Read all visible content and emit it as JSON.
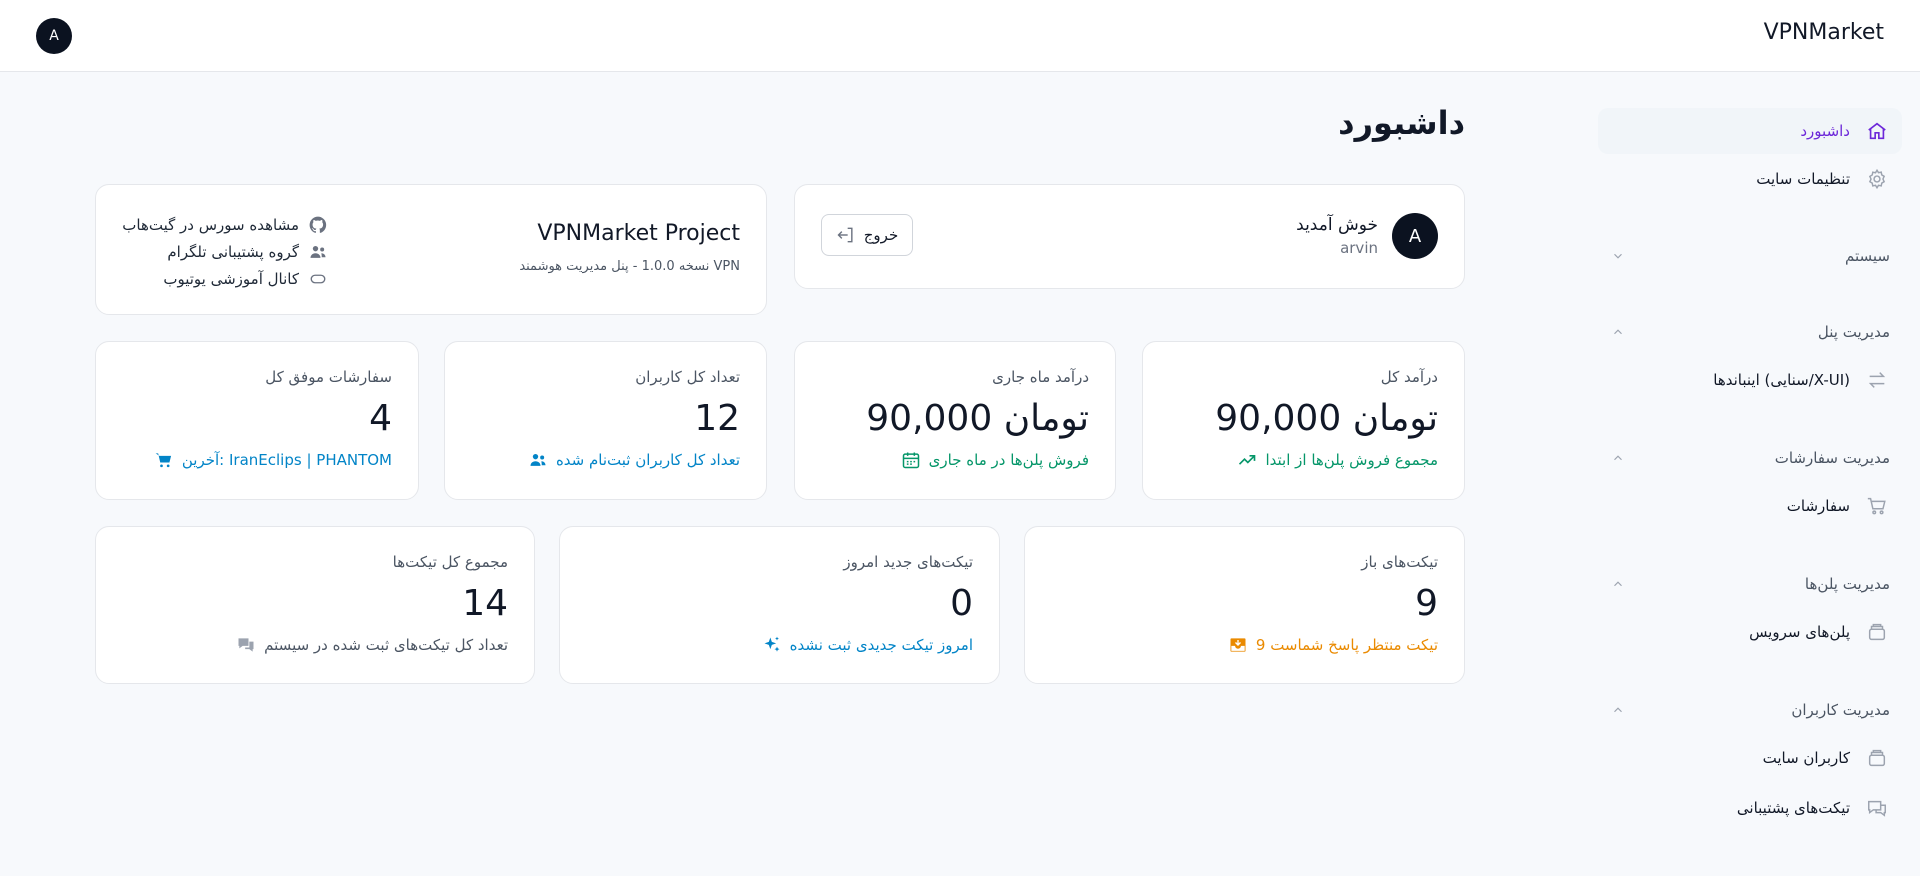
{
  "header": {
    "brand": "VPNMarket",
    "user_initial": "A"
  },
  "sidebar": {
    "items": [
      {
        "label": "داشبورد",
        "icon": "home-icon",
        "active": true
      },
      {
        "label": "تنظیمات سایت",
        "icon": "gear-icon"
      }
    ],
    "groups": [
      {
        "label": "سیستم",
        "expanded": false
      },
      {
        "label": "مدیریت پنل",
        "expanded": true,
        "items": [
          {
            "label": "اینباندها (سنایی/X-UI)",
            "icon": "arrows-swap-icon"
          }
        ]
      },
      {
        "label": "مدیریت سفارشات",
        "expanded": true,
        "items": [
          {
            "label": "سفارشات",
            "icon": "cart-icon"
          }
        ]
      },
      {
        "label": "مدیریت پلن‌ها",
        "expanded": true,
        "items": [
          {
            "label": "پلن‌های سرویس",
            "icon": "box-icon"
          }
        ]
      },
      {
        "label": "مدیریت کاربران",
        "expanded": true,
        "items": [
          {
            "label": "کاربران سایت",
            "icon": "box-icon"
          },
          {
            "label": "تیکت‌های پشتیبانی",
            "icon": "chat-icon"
          }
        ]
      }
    ]
  },
  "main": {
    "title": "داشبورد",
    "welcome": {
      "title": "خوش آمدید",
      "username": "arvin",
      "avatar_initial": "A",
      "logout_label": "خروج"
    },
    "project": {
      "title": "VPNMarket Project",
      "subtitle": "نسخه 1.0.0 - پنل مدیریت هوشمند VPN",
      "links": [
        {
          "label": "مشاهده سورس در گیت‌هاب",
          "icon": "github-icon"
        },
        {
          "label": "گروه پشتیبانی تلگرام",
          "icon": "users-icon"
        },
        {
          "label": "کانال آموزشی یوتیوب",
          "icon": "youtube-icon"
        }
      ]
    },
    "stats": [
      {
        "label": "درآمد کل",
        "value": "90,000 تومان",
        "desc": "مجموع فروش پلن‌ها از ابتدا",
        "color": "#059669",
        "icon": "trend-up-icon"
      },
      {
        "label": "درآمد ماه جاری",
        "value": "90,000 تومان",
        "desc": "فروش پلن‌ها در ماه جاری",
        "color": "#059669",
        "icon": "calendar-icon"
      },
      {
        "label": "تعداد کل کاربران",
        "value": "12",
        "desc": "تعداد کل کاربران ثبت‌نام شده",
        "color": "#0284c7",
        "icon": "users-icon"
      },
      {
        "label": "سفارشات موفق کل",
        "value": "4",
        "desc": "آخرین: IranEclips | PHANTOM",
        "color": "#0284c7",
        "icon": "cart-icon"
      }
    ],
    "tickets": [
      {
        "label": "تیکت‌های باز",
        "value": "9",
        "desc": "9 تیکت منتظر پاسخ شماست",
        "color": "#ea8a00",
        "icon": "inbox-icon"
      },
      {
        "label": "تیکت‌های جدید امروز",
        "value": "0",
        "desc": "امروز تیکت جدیدی ثبت نشده",
        "color": "#0284c7",
        "icon": "sparkles-icon"
      },
      {
        "label": "مجموع کل تیکت‌ها",
        "value": "14",
        "desc": "تعداد کل تیکت‌های ثبت شده در سیستم",
        "color": "#4b5563",
        "icon": "chat-icon"
      }
    ]
  }
}
